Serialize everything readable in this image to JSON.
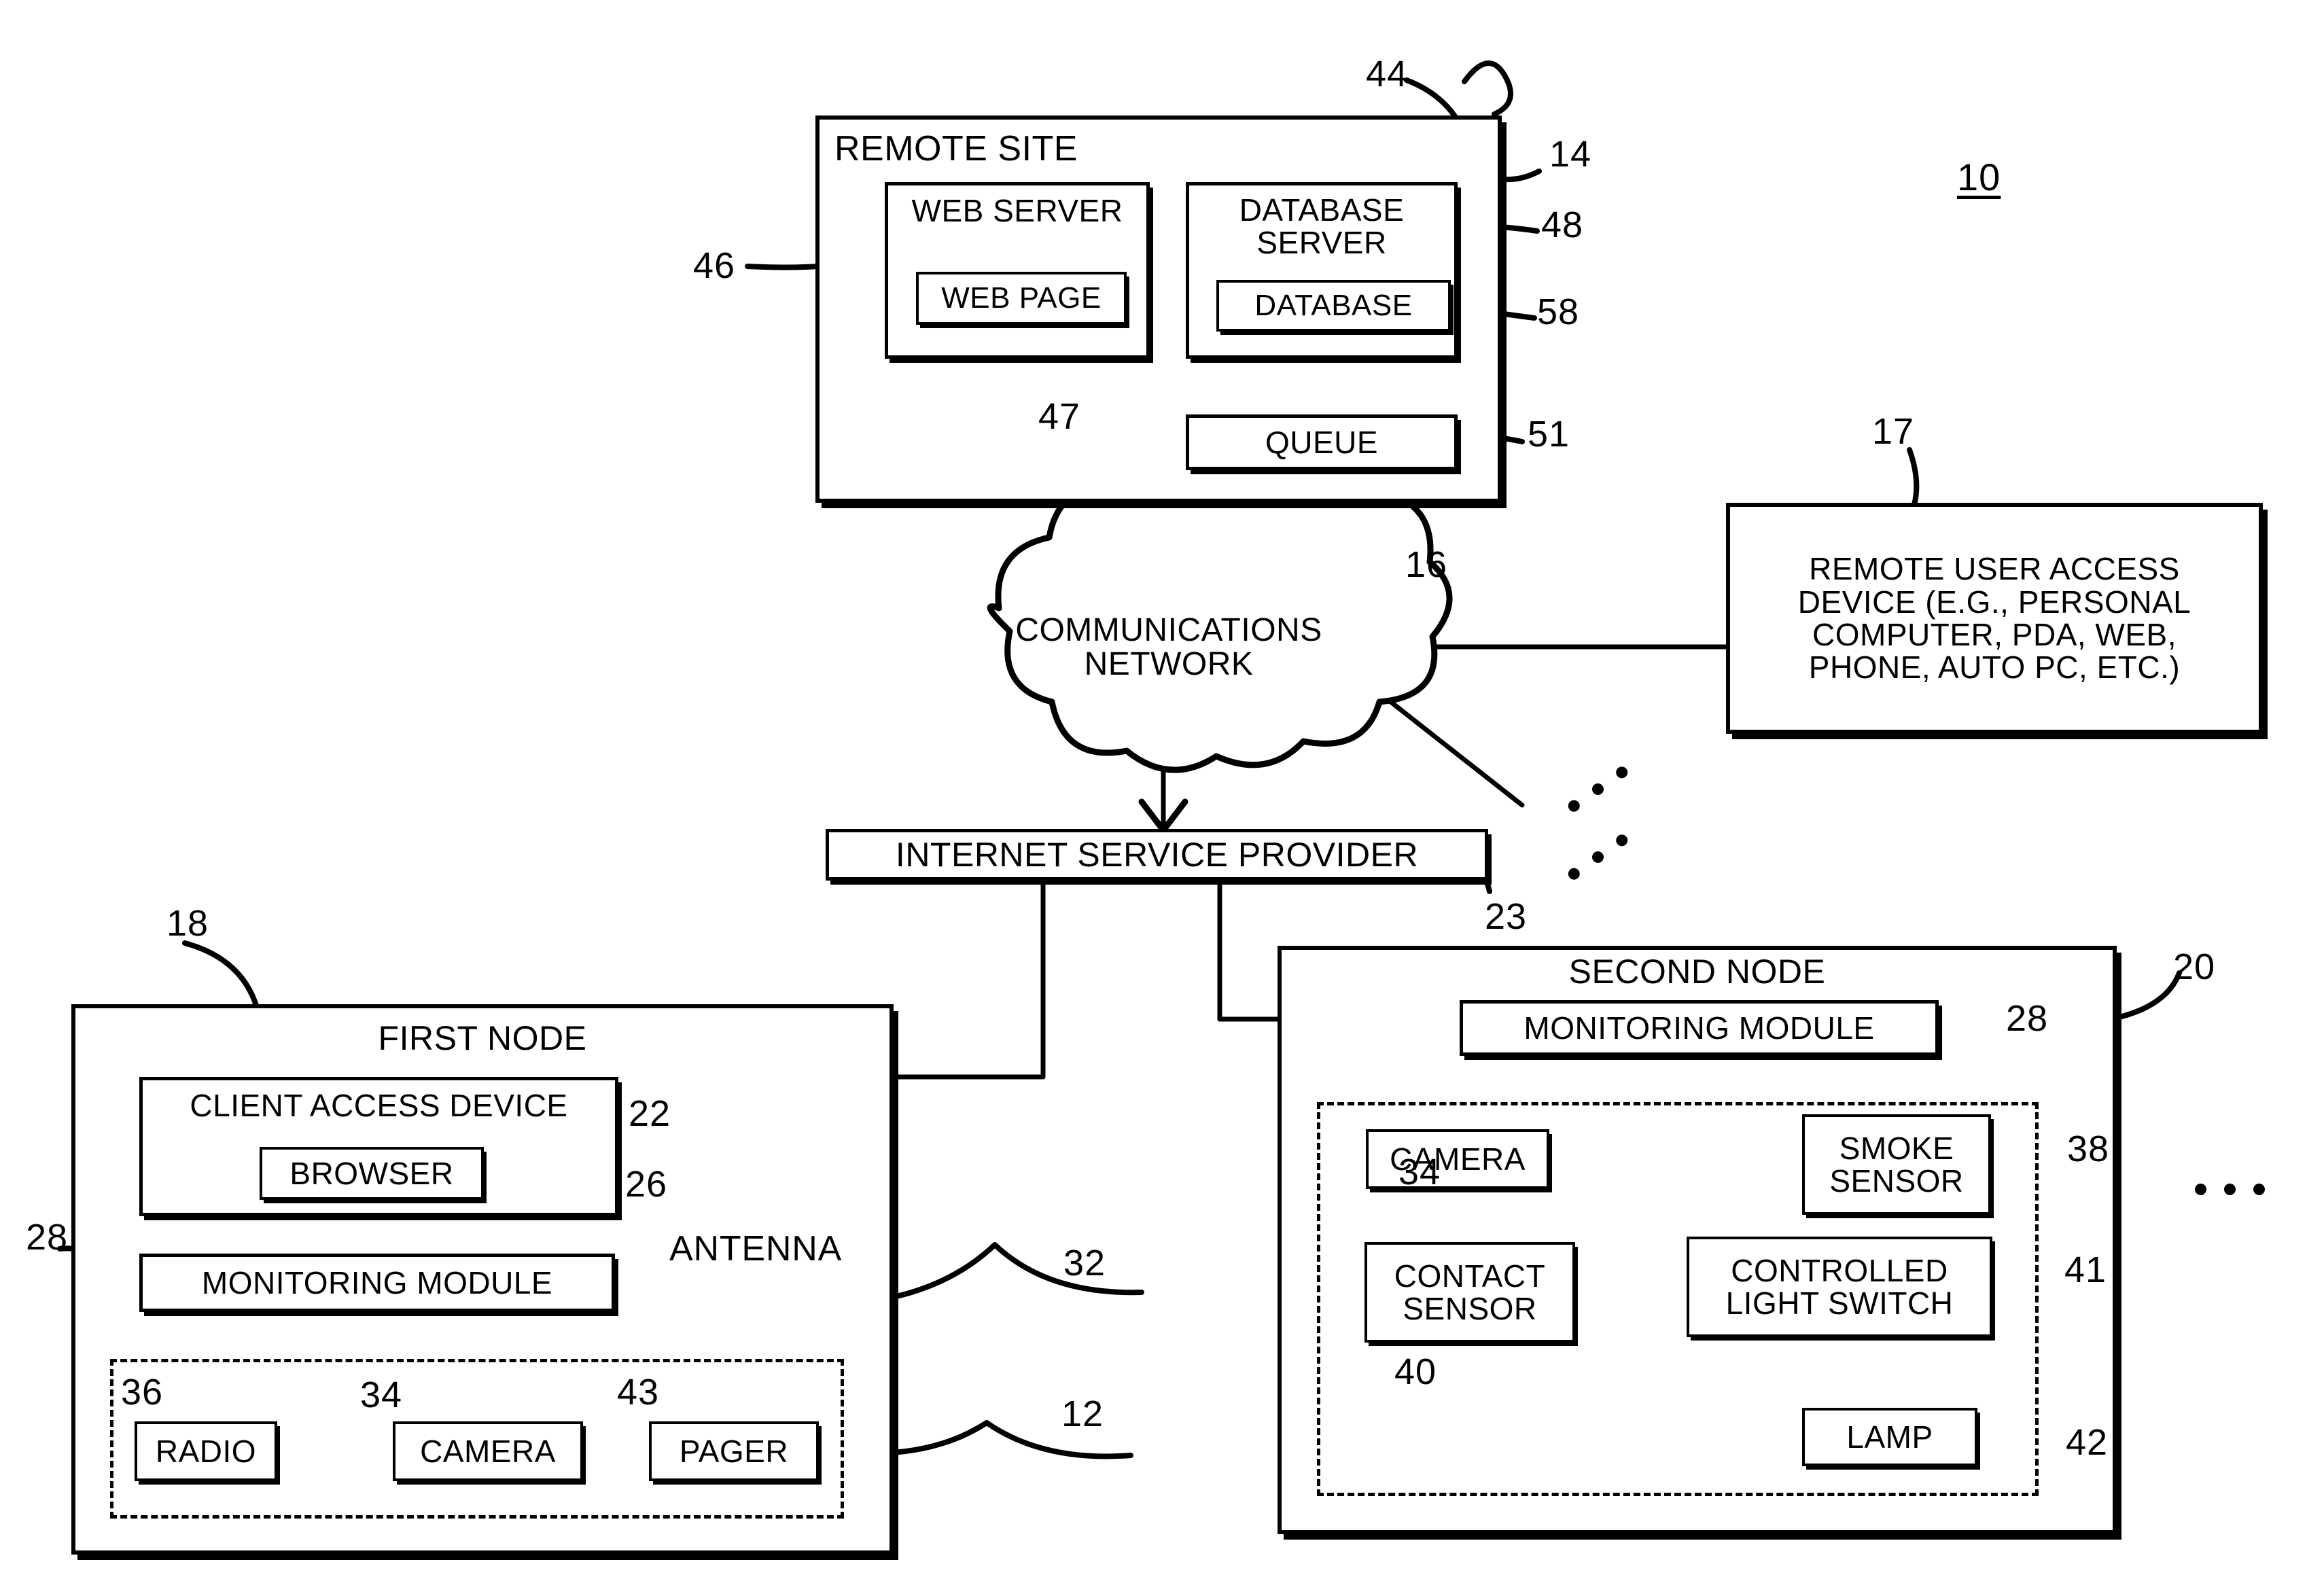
{
  "figure": {
    "number": "10",
    "type": "patent-block-diagram"
  },
  "remote_site": {
    "title": "REMOTE SITE",
    "ref": "14",
    "ref_corner": "44",
    "web_server": {
      "title": "WEB SERVER",
      "ref": "46",
      "web_page": {
        "title": "WEB PAGE",
        "ref": "47"
      }
    },
    "database_server": {
      "title": "DATABASE\nSERVER",
      "ref": "48",
      "database": {
        "title": "DATABASE",
        "ref": "58"
      }
    },
    "queue": {
      "title": "QUEUE",
      "ref": "51"
    }
  },
  "network": {
    "title": "COMMUNICATIONS\nNETWORK",
    "ref": "16"
  },
  "remote_user_access_device": {
    "title": "REMOTE USER ACCESS\nDEVICE (E.G., PERSONAL\nCOMPUTER, PDA, WEB,\nPHONE, AUTO PC, ETC.)",
    "ref": "17"
  },
  "isp": {
    "title": "INTERNET SERVICE PROVIDER",
    "ref": "23"
  },
  "first_node": {
    "title": "FIRST NODE",
    "ref": "18",
    "client_access_device": {
      "title": "CLIENT ACCESS DEVICE",
      "ref": "22",
      "browser": {
        "title": "BROWSER",
        "ref": "26"
      }
    },
    "monitoring_module": {
      "title": "MONITORING MODULE",
      "ref": "28"
    },
    "antenna": {
      "title": "ANTENNA"
    },
    "device_group_ref": "32",
    "devices": [
      {
        "title": "RADIO",
        "ref": "36",
        "icon": null
      },
      {
        "title": "CAMERA",
        "ref": "34",
        "icon": null
      },
      {
        "title": "PAGER",
        "ref": "43",
        "icon": "beacon-starburst-icon"
      }
    ]
  },
  "second_node": {
    "title": "SECOND NODE",
    "ref": "20",
    "monitoring_module": {
      "title": "MONITORING MODULE",
      "ref": "28"
    },
    "device_group_ref": "12",
    "devices": [
      {
        "title": "CAMERA",
        "ref": "34"
      },
      {
        "title": "CONTACT\nSENSOR",
        "ref": "40"
      },
      {
        "title": "SMOKE\nSENSOR",
        "ref": "38"
      },
      {
        "title": "CONTROLLED\nLIGHT SWITCH",
        "ref": "41"
      },
      {
        "title": "LAMP",
        "ref": "42"
      }
    ]
  },
  "ellipses": {
    "network_branch_upper": "...",
    "network_branch_lower": "...",
    "nodes_continuation": "..."
  },
  "colors": {
    "ink": "#000000",
    "paper": "#ffffff"
  }
}
